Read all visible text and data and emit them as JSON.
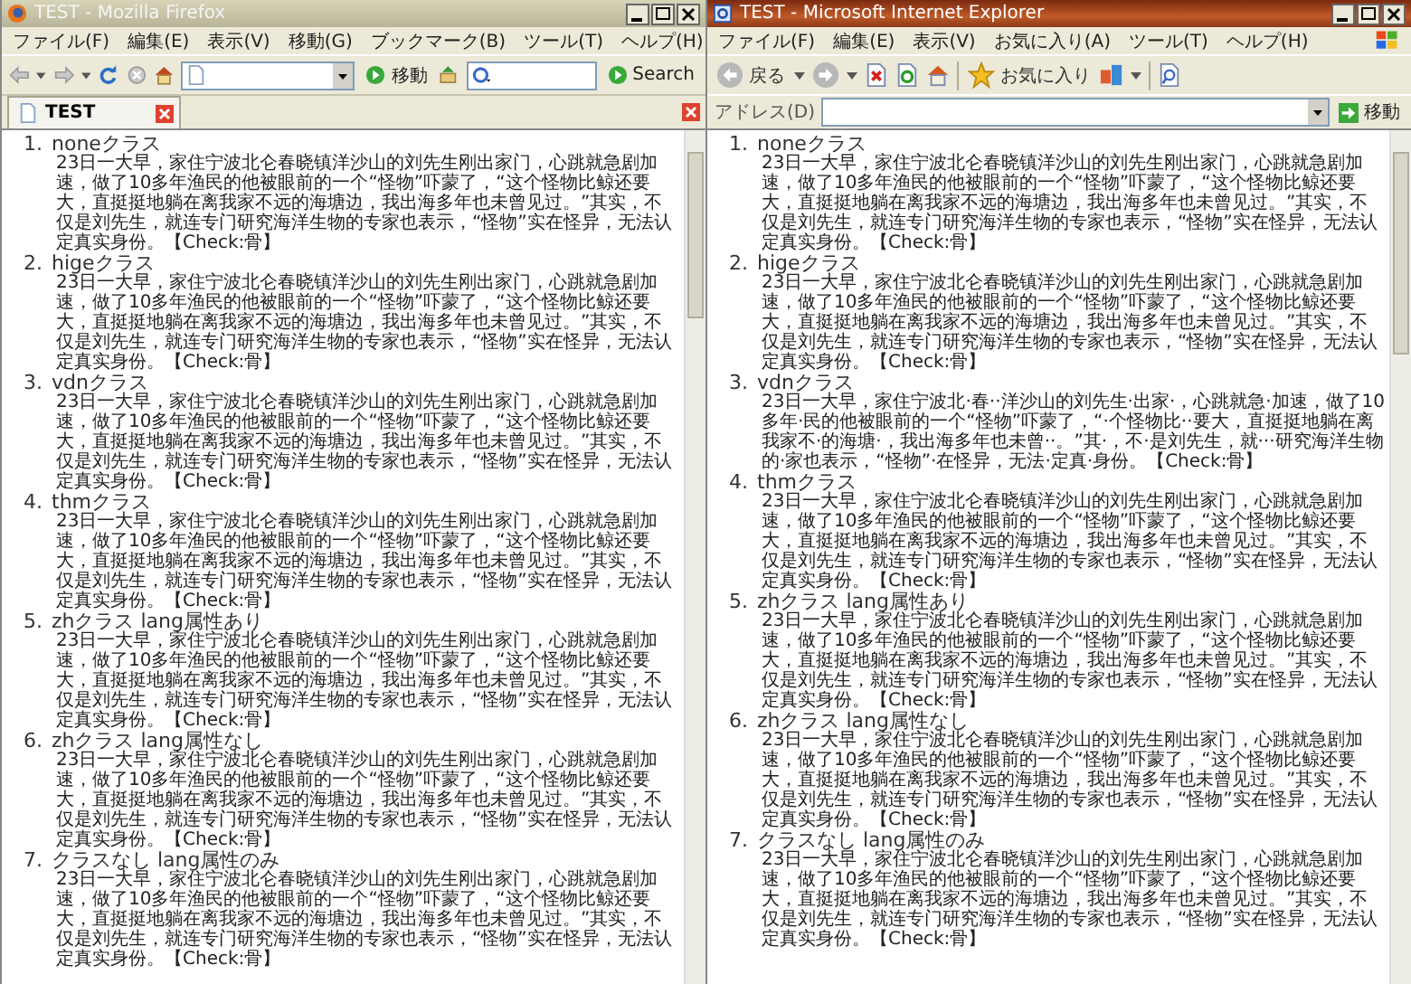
{
  "windows": [
    {
      "kind": "firefox",
      "title": "TEST - Mozilla Firefox",
      "menu": [
        "ファイル(F)",
        "編集(E)",
        "表示(V)",
        "移動(G)",
        "ブックマーク(B)",
        "ツール(T)",
        "ヘルプ(H)"
      ],
      "toolbar": {
        "go_label": "移動",
        "search_label": "Search"
      },
      "tab": {
        "label": "TEST"
      },
      "items": [
        {
          "number": "1.",
          "heading": "noneクラス",
          "body": "23日一大早，家住宁波北仑春晓镇洋沙山的刘先生刚出家门，心跳就急剧加速，做了10多年渔民的他被眼前的一个“怪物”吓蒙了，“这个怪物比鲸还要大，直挺挺地躺在离我家不远的海塘边，我出海多年也未曾见过。”其实，不仅是刘先生，就连专门研究海洋生物的专家也表示，“怪物”实在怪异，无法认定真实身份。【Check:骨】"
        },
        {
          "number": "2.",
          "heading": "higeクラス",
          "body": "23日一大早，家住宁波北仑春晓镇洋沙山的刘先生刚出家门，心跳就急剧加速，做了10多年渔民的他被眼前的一个“怪物”吓蒙了，“这个怪物比鲸还要大，直挺挺地躺在离我家不远的海塘边，我出海多年也未曾见过。”其实，不仅是刘先生，就连专门研究海洋生物的专家也表示，“怪物”实在怪异，无法认定真实身份。【Check:骨】"
        },
        {
          "number": "3.",
          "heading": "vdnクラス",
          "body": "23日一大早，家住宁波北仑春晓镇洋沙山的刘先生刚出家门，心跳就急剧加速，做了10多年渔民的他被眼前的一个“怪物”吓蒙了，“这个怪物比鲸还要大，直挺挺地躺在离我家不远的海塘边，我出海多年也未曾见过。”其实，不仅是刘先生，就连专门研究海洋生物的专家也表示，“怪物”实在怪异，无法认定真实身份。【Check:骨】"
        },
        {
          "number": "4.",
          "heading": "thmクラス",
          "body": "23日一大早，家住宁波北仑春晓镇洋沙山的刘先生刚出家门，心跳就急剧加速，做了10多年渔民的他被眼前的一个“怪物”吓蒙了，“这个怪物比鲸还要大，直挺挺地躺在离我家不远的海塘边，我出海多年也未曾见过。”其实，不仅是刘先生，就连专门研究海洋生物的专家也表示，“怪物”实在怪异，无法认定真实身份。【Check:骨】"
        },
        {
          "number": "5.",
          "heading": "zhクラス lang属性あり",
          "body": "23日一大早，家住宁波北仑春晓镇洋沙山的刘先生刚出家门，心跳就急剧加速，做了10多年渔民的他被眼前的一个“怪物”吓蒙了，“这个怪物比鲸还要大，直挺挺地躺在离我家不远的海塘边，我出海多年也未曾见过。”其实，不仅是刘先生，就连专门研究海洋生物的专家也表示，“怪物”实在怪异，无法认定真实身份。【Check:骨】"
        },
        {
          "number": "6.",
          "heading": "zhクラス lang属性なし",
          "body": "23日一大早，家住宁波北仑春晓镇洋沙山的刘先生刚出家门，心跳就急剧加速，做了10多年渔民的他被眼前的一个“怪物”吓蒙了，“这个怪物比鲸还要大，直挺挺地躺在离我家不远的海塘边，我出海多年也未曾见过。”其实，不仅是刘先生，就连专门研究海洋生物的专家也表示，“怪物”实在怪异，无法认定真实身份。【Check:骨】"
        },
        {
          "number": "7.",
          "heading": "クラスなし lang属性のみ",
          "body": "23日一大早，家住宁波北仑春晓镇洋沙山的刘先生刚出家门，心跳就急剧加速，做了10多年渔民的他被眼前的一个“怪物”吓蒙了，“这个怪物比鲸还要大，直挺挺地躺在离我家不远的海塘边，我出海多年也未曾见过。”其实，不仅是刘先生，就连专门研究海洋生物的专家也表示，“怪物”实在怪异，无法认定真实身份。【Check:骨】"
        }
      ]
    },
    {
      "kind": "ie",
      "title": "TEST - Microsoft Internet Explorer",
      "menu": [
        "ファイル(F)",
        "編集(E)",
        "表示(V)",
        "お気に入り(A)",
        "ツール(T)",
        "ヘルプ(H)"
      ],
      "toolbar": {
        "back_label": "戻る",
        "favorites_label": "お気に入り"
      },
      "address": {
        "label": "アドレス(D)",
        "go_label": "移動"
      },
      "items": [
        {
          "number": "1.",
          "heading": "noneクラス",
          "body": "23日一大早，家住宁波北仑春晓镇洋沙山的刘先生刚出家门，心跳就急剧加速，做了10多年渔民的他被眼前的一个“怪物”吓蒙了，“这个怪物比鲸还要大，直挺挺地躺在离我家不远的海塘边，我出海多年也未曾见过。”其实，不仅是刘先生，就连专门研究海洋生物的专家也表示，“怪物”实在怪异，无法认定真实身份。【Check:骨】"
        },
        {
          "number": "2.",
          "heading": "higeクラス",
          "body": "23日一大早，家住宁波北仑春晓镇洋沙山的刘先生刚出家门，心跳就急剧加速，做了10多年渔民的他被眼前的一个“怪物”吓蒙了，“这个怪物比鲸还要大，直挺挺地躺在离我家不远的海塘边，我出海多年也未曾见过。”其实，不仅是刘先生，就连专门研究海洋生物的专家也表示，“怪物”实在怪异，无法认定真实身份。【Check:骨】"
        },
        {
          "number": "3.",
          "heading": "vdnクラス",
          "body": "23日一大早，家住宁波北·春··洋沙山的刘先生·出家·，心跳就急·加速，做了10多年·民的他被眼前的一个“怪物”吓蒙了，“·个怪物比··要大，直挺挺地躺在离我家不·的海塘·，我出海多年也未曾··。”其·，不·是刘先生，就···研究海洋生物的·家也表示，“怪物”·在怪异，无法·定真·身份。【Check:骨】"
        },
        {
          "number": "4.",
          "heading": "thmクラス",
          "body": "23日一大早，家住宁波北仑春晓镇洋沙山的刘先生刚出家门，心跳就急剧加速，做了10多年渔民的他被眼前的一个“怪物”吓蒙了，“这个怪物比鲸还要大，直挺挺地躺在离我家不远的海塘边，我出海多年也未曾见过。”其实，不仅是刘先生，就连专门研究海洋生物的专家也表示，“怪物”实在怪异，无法认定真实身份。【Check:骨】"
        },
        {
          "number": "5.",
          "heading": "zhクラス lang属性あり",
          "body": "23日一大早，家住宁波北仑春晓镇洋沙山的刘先生刚出家门，心跳就急剧加速，做了10多年渔民的他被眼前的一个“怪物”吓蒙了，“这个怪物比鲸还要大，直挺挺地躺在离我家不远的海塘边，我出海多年也未曾见过。”其实，不仅是刘先生，就连专门研究海洋生物的专家也表示，“怪物”实在怪异，无法认定真实身份。【Check:骨】"
        },
        {
          "number": "6.",
          "heading": "zhクラス lang属性なし",
          "body": "23日一大早，家住宁波北仑春晓镇洋沙山的刘先生刚出家门，心跳就急剧加速，做了10多年渔民的他被眼前的一个“怪物”吓蒙了，“这个怪物比鲸还要大，直挺挺地躺在离我家不远的海塘边，我出海多年也未曾见过。”其实，不仅是刘先生，就连专门研究海洋生物的专家也表示，“怪物”实在怪异，无法认定真实身份。【Check:骨】"
        },
        {
          "number": "7.",
          "heading": "クラスなし lang属性のみ",
          "body": "23日一大早，家住宁波北仑春晓镇洋沙山的刘先生刚出家门，心跳就急剧加速，做了10多年渔民的他被眼前的一个“怪物”吓蒙了，“这个怪物比鲸还要大，直挺挺地躺在离我家不远的海塘边，我出海多年也未曾见过。”其实，不仅是刘先生，就连专门研究海洋生物的专家也表示，“怪物”实在怪异，无法认定真实身份。【Check:骨】"
        }
      ]
    }
  ]
}
